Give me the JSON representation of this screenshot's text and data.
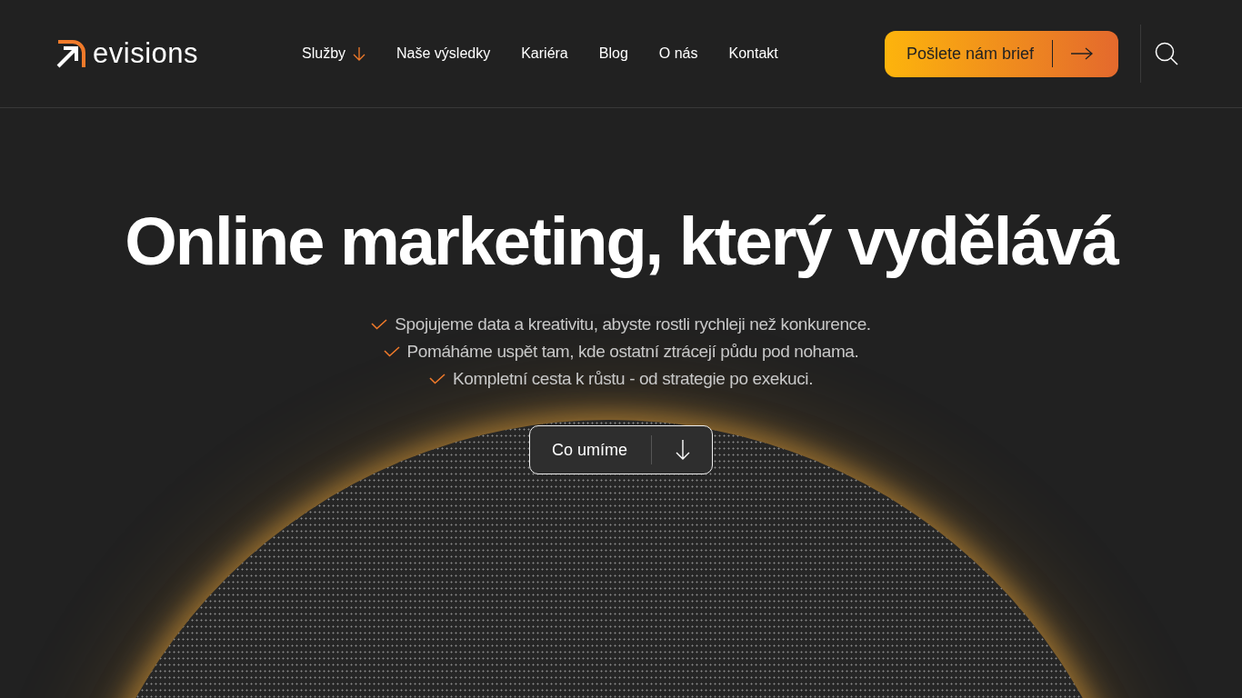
{
  "header": {
    "logo": "evisions",
    "nav": [
      {
        "label": "Služby",
        "dropdown": true
      },
      {
        "label": "Naše výsledky",
        "dropdown": false
      },
      {
        "label": "Kariéra",
        "dropdown": false
      },
      {
        "label": "Blog",
        "dropdown": false
      },
      {
        "label": "O nás",
        "dropdown": false
      },
      {
        "label": "Kontakt",
        "dropdown": false
      }
    ],
    "cta": "Pošlete nám brief"
  },
  "hero": {
    "title": "Online marketing, který vydělává",
    "bullets": [
      "Spojujeme data a kreativitu, abyste rostli rychleji než konkurence.",
      "Pomáháme uspět tam, kde ostatní ztrácejí půdu pod nohama.",
      "Kompletní cesta k růstu - od strategie po exekuci."
    ],
    "button": "Co umíme"
  }
}
